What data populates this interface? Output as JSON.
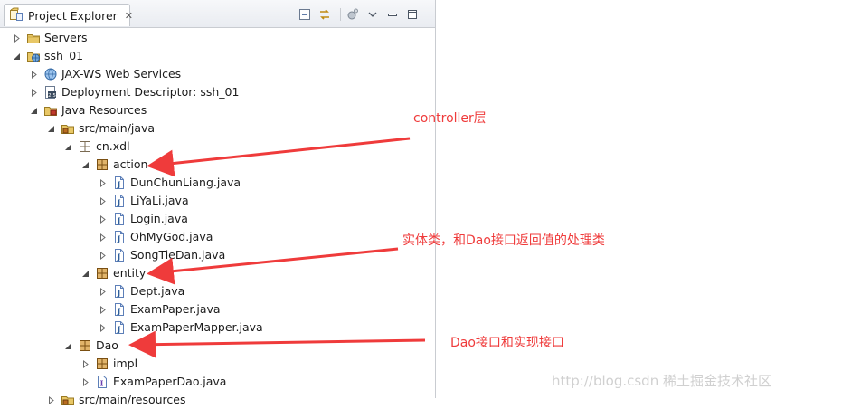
{
  "panel": {
    "tab_title": "Project Explorer",
    "tab_close": "✕"
  },
  "tree": [
    {
      "label": "Servers",
      "depth": 0,
      "expanded": false,
      "icon": "folder-icon"
    },
    {
      "label": "ssh_01",
      "depth": 0,
      "expanded": true,
      "icon": "web-project-icon"
    },
    {
      "label": "JAX-WS Web Services",
      "depth": 1,
      "expanded": false,
      "icon": "webservice-icon"
    },
    {
      "label": "Deployment Descriptor: ssh_01",
      "depth": 1,
      "expanded": false,
      "icon": "descriptor-icon"
    },
    {
      "label": "Java Resources",
      "depth": 1,
      "expanded": true,
      "icon": "java-resources-icon"
    },
    {
      "label": "src/main/java",
      "depth": 2,
      "expanded": true,
      "icon": "source-folder-icon"
    },
    {
      "label": "cn.xdl",
      "depth": 3,
      "expanded": true,
      "icon": "package-empty-icon"
    },
    {
      "label": "action",
      "depth": 4,
      "expanded": true,
      "icon": "package-icon"
    },
    {
      "label": "DunChunLiang.java",
      "depth": 5,
      "expanded": false,
      "icon": "java-file-icon"
    },
    {
      "label": "LiYaLi.java",
      "depth": 5,
      "expanded": false,
      "icon": "java-file-icon"
    },
    {
      "label": "Login.java",
      "depth": 5,
      "expanded": false,
      "icon": "java-file-icon"
    },
    {
      "label": "OhMyGod.java",
      "depth": 5,
      "expanded": false,
      "icon": "java-file-icon"
    },
    {
      "label": "SongTieDan.java",
      "depth": 5,
      "expanded": false,
      "icon": "java-file-icon"
    },
    {
      "label": "entity",
      "depth": 4,
      "expanded": true,
      "icon": "package-icon"
    },
    {
      "label": "Dept.java",
      "depth": 5,
      "expanded": false,
      "icon": "java-file-icon"
    },
    {
      "label": "ExamPaper.java",
      "depth": 5,
      "expanded": false,
      "icon": "java-file-icon"
    },
    {
      "label": "ExamPaperMapper.java",
      "depth": 5,
      "expanded": false,
      "icon": "java-file-icon"
    },
    {
      "label": "Dao",
      "depth": 3,
      "expanded": true,
      "icon": "package-icon"
    },
    {
      "label": "impl",
      "depth": 4,
      "expanded": false,
      "icon": "package-icon"
    },
    {
      "label": "ExamPaperDao.java",
      "depth": 4,
      "expanded": false,
      "icon": "java-interface-icon"
    },
    {
      "label": "src/main/resources",
      "depth": 2,
      "expanded": false,
      "icon": "source-folder-icon"
    }
  ],
  "annotations": {
    "controller": "controller层",
    "entity": "实体类，和Dao接口返回值的处理类",
    "dao": "Dao接口和实现接口"
  },
  "watermark": "http://blog.csdn 稀土掘金技术社区",
  "colors": {
    "annotation": "#ef3b3b",
    "selection": "#cfe3ff"
  }
}
